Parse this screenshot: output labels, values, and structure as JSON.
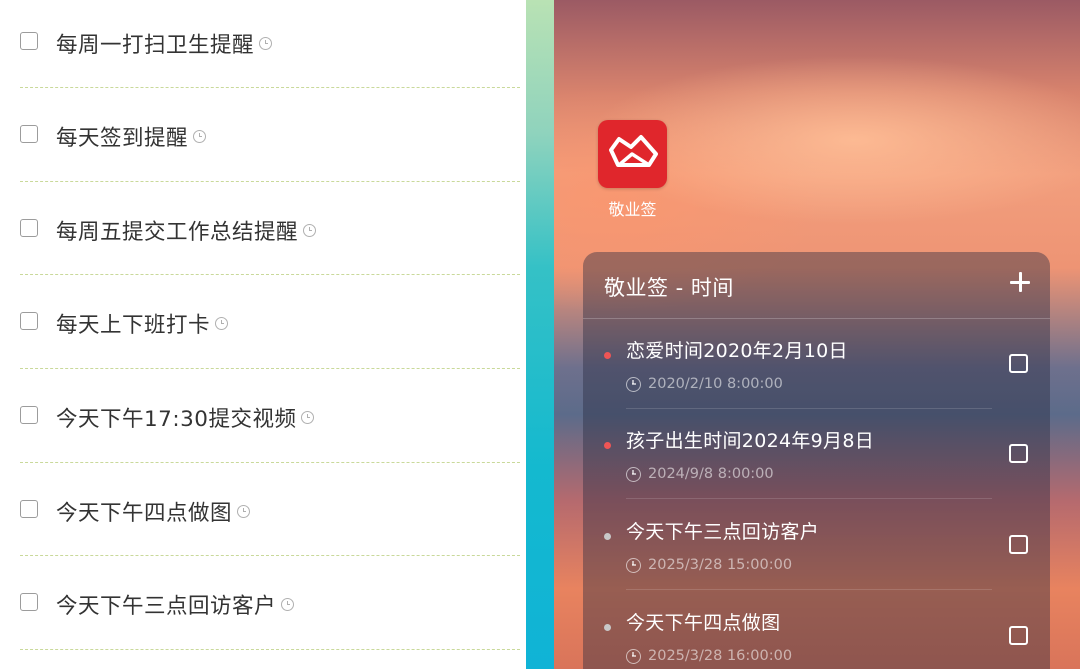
{
  "left_list": {
    "items": [
      {
        "text": "每周一打扫卫生提醒"
      },
      {
        "text": "每天签到提醒"
      },
      {
        "text": "每周五提交工作总结提醒"
      },
      {
        "text": "每天上下班打卡"
      },
      {
        "text": "今天下午17:30提交视频"
      },
      {
        "text": "今天下午四点做图"
      },
      {
        "text": "今天下午三点回访客户"
      }
    ]
  },
  "app": {
    "name": "敬业签",
    "icon": "app-logo-icon",
    "icon_color": "#e0262c"
  },
  "widget": {
    "title": "敬业签 - 时间",
    "add_icon": "plus-icon",
    "items": [
      {
        "title": "恋爱时间2020年2月10日",
        "time": "2020/2/10 8:00:00",
        "dot_color": "#ef5555"
      },
      {
        "title": "孩子出生时间2024年9月8日",
        "time": "2024/9/8 8:00:00",
        "dot_color": "#ef5555"
      },
      {
        "title": "今天下午三点回访客户",
        "time": "2025/3/28 15:00:00",
        "dot_color": "#c8c8c8"
      },
      {
        "title": "今天下午四点做图",
        "time": "2025/3/28 16:00:00",
        "dot_color": "#c8c8c8"
      }
    ]
  }
}
